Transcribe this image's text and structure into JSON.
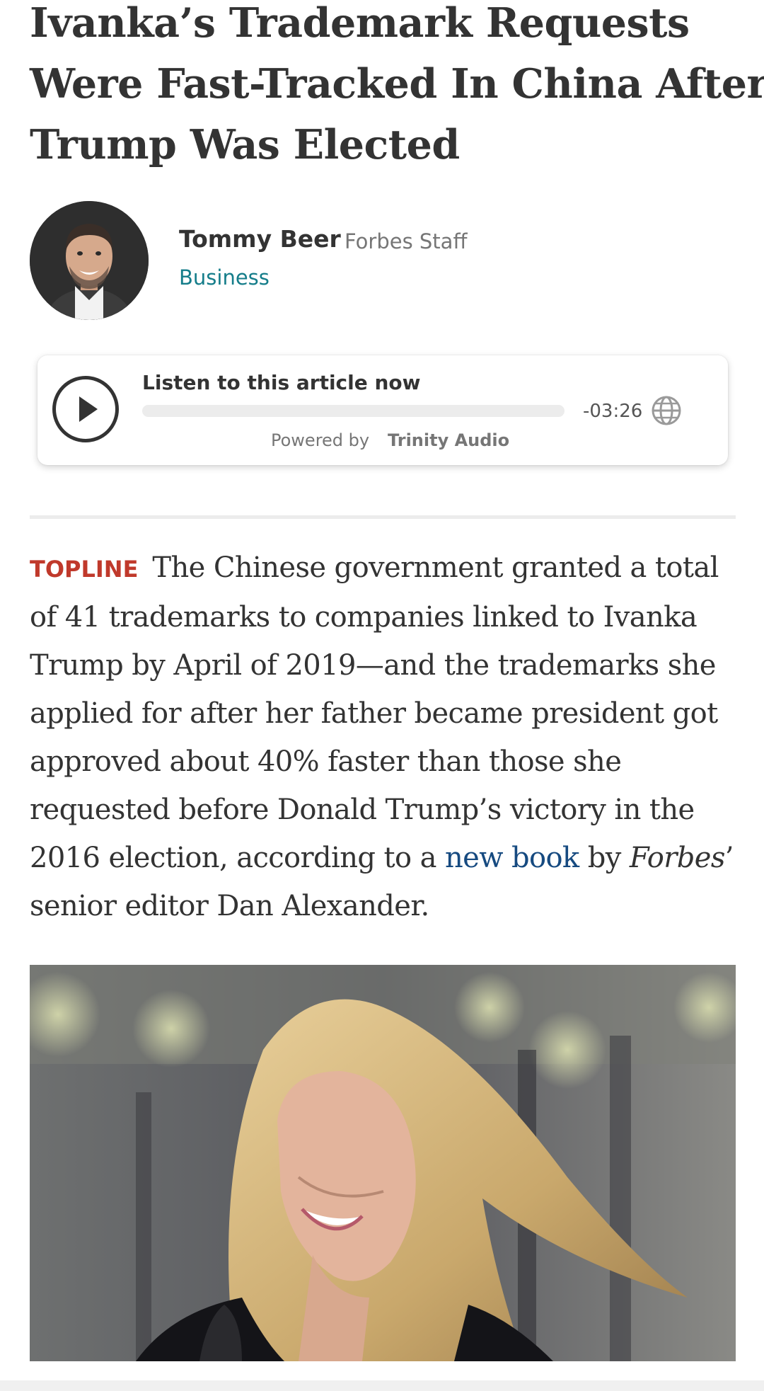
{
  "article": {
    "headline_lines": [
      "Ivanka’s Trademark Requests",
      "Were Fast-Tracked In China After",
      "Trump Was Elected"
    ],
    "author": {
      "name": "Tommy Beer",
      "role": "Forbes Staff",
      "section": "Business"
    },
    "audio_player": {
      "title": "Listen to this article now",
      "time_remaining": "-03:26",
      "powered_by": "Powered by",
      "provider": "Trinity Audio",
      "progress": 0,
      "icons": [
        "play-icon",
        "globe-icon"
      ]
    },
    "topline_label": "TOPLINE",
    "body_lines": [
      [
        "The Chinese government granted a total"
      ],
      [
        "of 41 trademarks to companies linked to Ivanka"
      ],
      [
        "Trump by April of 2019—and the trademarks she"
      ],
      [
        "applied for after her father became president got"
      ],
      [
        "approved about 40% faster than those she"
      ],
      [
        "requested before Donald Trump’s victory in the"
      ],
      [
        "2016 election, according to a ",
        "new book",
        " by ",
        "Forbes",
        "’"
      ],
      [
        "senior editor Dan Alexander."
      ]
    ],
    "colors": {
      "topline": "#c0392b",
      "section_link": "#157d8a",
      "inline_link": "#164a80",
      "text": "#333333"
    }
  }
}
